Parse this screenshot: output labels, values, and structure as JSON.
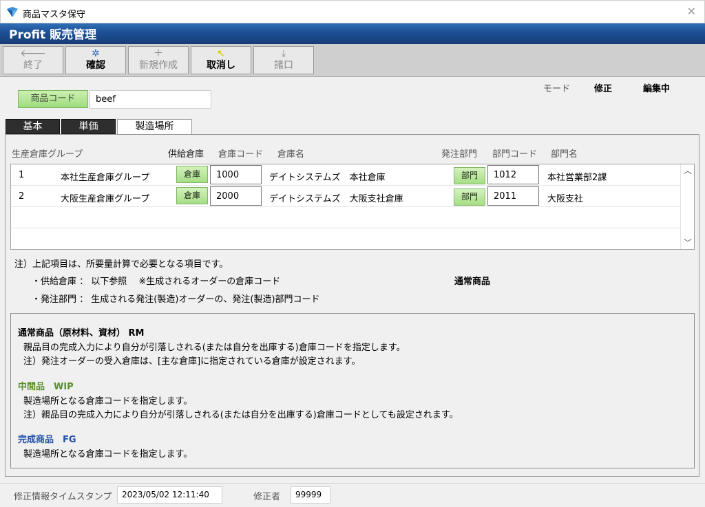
{
  "window": {
    "title": "商品マスタ保守"
  },
  "brand": {
    "title": "Profit 販売管理"
  },
  "toolbar": {
    "buttons": [
      {
        "label": "終了",
        "icon": "arrow-left-icon",
        "enabled": false
      },
      {
        "label": "確認",
        "icon": "gear-icon",
        "enabled": true
      },
      {
        "label": "新規作成",
        "icon": "plus-icon",
        "enabled": false
      },
      {
        "label": "取消し",
        "icon": "undo-icon",
        "enabled": true
      },
      {
        "label": "諸口",
        "icon": "download-icon",
        "enabled": false
      }
    ]
  },
  "header": {
    "code_button": "商品コード",
    "code_value": "beef",
    "mode_label": "モード",
    "mode_value": "修正",
    "mode_status": "編集中"
  },
  "tabs": [
    {
      "label": "基本",
      "active": false
    },
    {
      "label": "単価",
      "active": false
    },
    {
      "label": "製造場所",
      "active": true
    }
  ],
  "grid": {
    "headers": {
      "group": "生産倉庫グループ",
      "warehouse": "供給倉庫",
      "warehouse_code": "倉庫コード",
      "warehouse_name": "倉庫名",
      "dept": "発注部門",
      "dept_code": "部門コード",
      "dept_name": "部門名"
    },
    "rows": [
      {
        "no": "1",
        "group": "本社生産倉庫グループ",
        "wh_btn": "倉庫",
        "wh_code": "1000",
        "wh_name": "デイトシステムズ　本社倉庫",
        "dept_btn": "部門",
        "dept_code": "1012",
        "dept_name": "本社営業部2課"
      },
      {
        "no": "2",
        "group": "大阪生産倉庫グループ",
        "wh_btn": "倉庫",
        "wh_code": "2000",
        "wh_name": "デイトシステムズ　大阪支社倉庫",
        "dept_btn": "部門",
        "dept_code": "2011",
        "dept_name": "大阪支社"
      }
    ]
  },
  "notes": {
    "line1": "注）上記項目は、所要量計算で必要となる項目です。",
    "line2": "・供給倉庫 ： 以下参照　 ※生成されるオーダーの倉庫コード",
    "line3": "・発注部門 ： 生成される発注(製造)オーダーの、発注(製造)部門コード",
    "item_type": "通常商品"
  },
  "info": {
    "rm_title": "通常商品（原材料、資材） RM",
    "rm_line1": "親品目の完成入力により自分が引落しされる(または自分を出庫する)倉庫コードを指定します。",
    "rm_line2": "注）発注オーダーの受入倉庫は、[主な倉庫]に指定されている倉庫が設定されます。",
    "wip_title": "中間品　WIP",
    "wip_line1": "製造場所となる倉庫コードを指定します。",
    "wip_line2": "注）親品目の完成入力により自分が引落しされる(または自分を出庫する)倉庫コードとしても設定されます。",
    "fg_title": "完成商品　FG",
    "fg_line1": "製造場所となる倉庫コードを指定します。",
    "colors": {
      "rm": "#000000",
      "wip": "#5a8f2a",
      "fg": "#1f4fa8"
    }
  },
  "footer": {
    "timestamp_label": "修正情報タイムスタンプ",
    "timestamp_value": "2023/05/02 12:11:40",
    "editor_label": "修正者",
    "editor_value": "99999"
  }
}
